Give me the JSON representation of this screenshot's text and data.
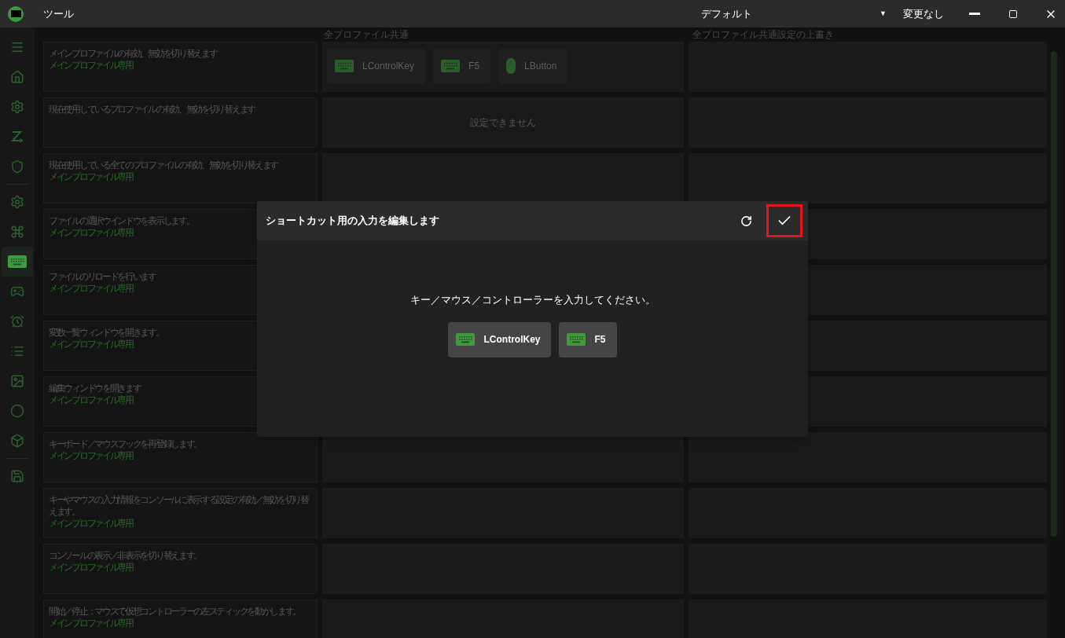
{
  "window": {
    "title": "ツール",
    "profile": {
      "value": "デフォルト",
      "arrow": "▼"
    },
    "status": "変更なし"
  },
  "sidebar": {
    "groups": [
      [
        {
          "selected": false
        },
        {
          "selected": false
        },
        {
          "selected": false
        },
        {
          "selected": false
        },
        {
          "selected": false
        }
      ],
      [
        {
          "selected": false
        },
        {
          "selected": false
        },
        {
          "selected": true
        },
        {
          "selected": false
        },
        {
          "selected": false
        },
        {
          "selected": false
        },
        {
          "selected": false
        },
        {
          "selected": false
        },
        {
          "selected": false
        }
      ],
      [
        {
          "selected": false
        }
      ]
    ]
  },
  "table": {
    "columns": [
      "全プロファイル共通",
      "全プロファイル共通設定の上書き"
    ],
    "rows": [
      {
        "description": "メインプロファイルの有効、無効を切り替えます",
        "note": "メインプロファイル専用",
        "shortcut": {
          "kind": "keys",
          "keys": [
            {
              "kind": "keyboard",
              "label": "LControlKey"
            },
            {
              "kind": "keyboard",
              "label": "F5"
            },
            {
              "kind": "mouse",
              "label": "LButton"
            }
          ]
        }
      },
      {
        "description": "現在使用しているプロファイルの有効、無効を切り替えます",
        "shortcut": {
          "kind": "unavailable",
          "text": "設定できません"
        }
      },
      {
        "description": "現在使用している全てのプロファイルの有効、無効を切り替えます",
        "note": "メインプロファイル専用"
      },
      {
        "description": "ファイルの選択ウインドウを表示します。",
        "note": "メインプロファイル専用"
      },
      {
        "description": "ファイルのリロードを行います",
        "note": "メインプロファイル専用"
      },
      {
        "description": "変数一覧ウィンドウを開きます。",
        "note": "メインプロファイル専用"
      },
      {
        "description": "編集ウィンドウを開きます",
        "note": "メインプロファイル専用"
      },
      {
        "description": "キーボード／マウスフックを再登録します。",
        "note": "メインプロファイル専用"
      },
      {
        "description": "キーやマウスの入力情報をコンソールに表示する設定の有効／無効を切り替えます。",
        "note": "メインプロファイル専用"
      },
      {
        "description": "コンソールの表示／非表示を切り替えます。",
        "note": "メインプロファイル専用"
      },
      {
        "description": "開始／停止：マウスで仮想コントローラーの左スティックを動かします。",
        "note": "メインプロファイル専用"
      }
    ]
  },
  "dialog": {
    "title": "ショートカット用の入力を編集します",
    "confirm_highlighted": true,
    "prompt": "キー／マウス／コントローラーを入力してください。",
    "keys": [
      {
        "kind": "keyboard",
        "label": "LControlKey"
      },
      {
        "kind": "keyboard",
        "label": "F5"
      }
    ]
  }
}
